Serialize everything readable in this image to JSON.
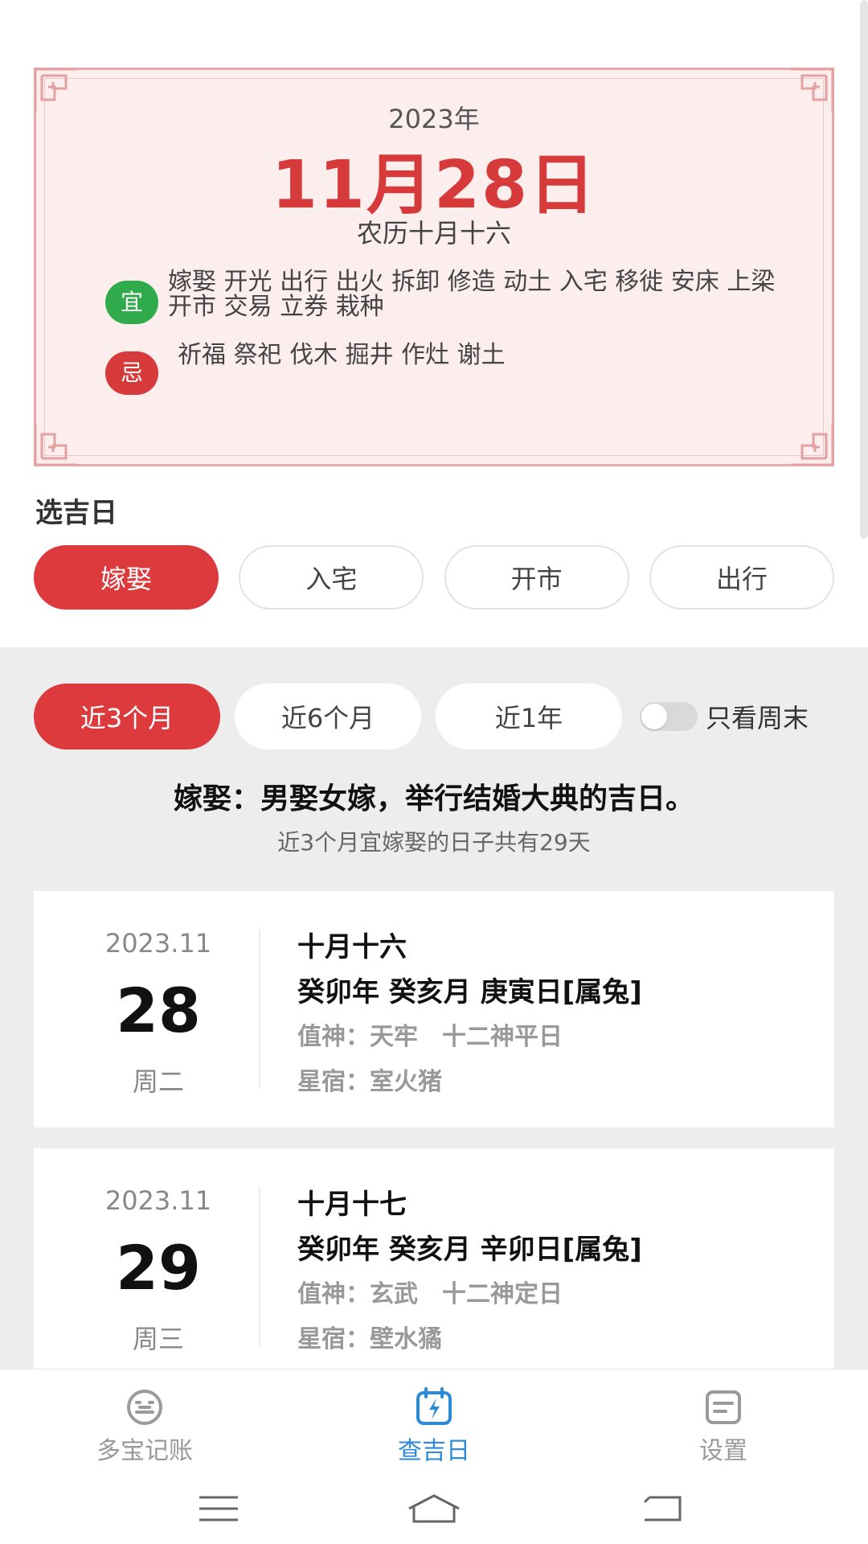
{
  "calendar": {
    "year": "2023年",
    "date": "11月28日",
    "lunar": "农历十月十六",
    "yi_label": "宜",
    "yi_text": "嫁娶 开光 出行 出火 拆卸 修造 动土 入宅 移徙 安床 上梁 开市 交易 立券 栽种",
    "ji_label": "忌",
    "ji_text": "祈福 祭祀 伐木 掘井 作灶 谢土"
  },
  "select_section": {
    "title": "选吉日",
    "tabs": [
      "嫁娶",
      "入宅",
      "开市",
      "出行"
    ],
    "active_tab": "嫁娶"
  },
  "range": {
    "options": [
      "近3个月",
      "近6个月",
      "近1年"
    ],
    "active": "近3个月",
    "weekend_only_label": "只看周末",
    "weekend_only": false
  },
  "summary": {
    "description": "嫁娶：男娶女嫁，举行结婚大典的吉日。",
    "count_text": "近3个月宜嫁娶的日子共有29天"
  },
  "days": [
    {
      "year_month": "2023.11",
      "day": "28",
      "weekday": "周二",
      "lunar": "十月十六",
      "ganzhi": "癸卯年 癸亥月 庚寅日[属兔]",
      "god": "值神：天牢　十二神平日",
      "star": "星宿：室火猪"
    },
    {
      "year_month": "2023.11",
      "day": "29",
      "weekday": "周三",
      "lunar": "十月十七",
      "ganzhi": "癸卯年 癸亥月 辛卯日[属兔]",
      "god": "值神：玄武　十二神定日",
      "star": "星宿：壁水獝"
    }
  ],
  "bottom_nav": [
    {
      "label": "多宝记账",
      "icon": "bookkeeping-icon",
      "active": false
    },
    {
      "label": "查吉日",
      "icon": "calendar-lightning-icon",
      "active": true
    },
    {
      "label": "设置",
      "icon": "settings-icon",
      "active": false
    }
  ],
  "colors": {
    "accent_red": "#dd3a3e",
    "yi_green": "#2fab4b",
    "nav_active_blue": "#2f8ad6",
    "card_bg": "#fdeeee"
  }
}
